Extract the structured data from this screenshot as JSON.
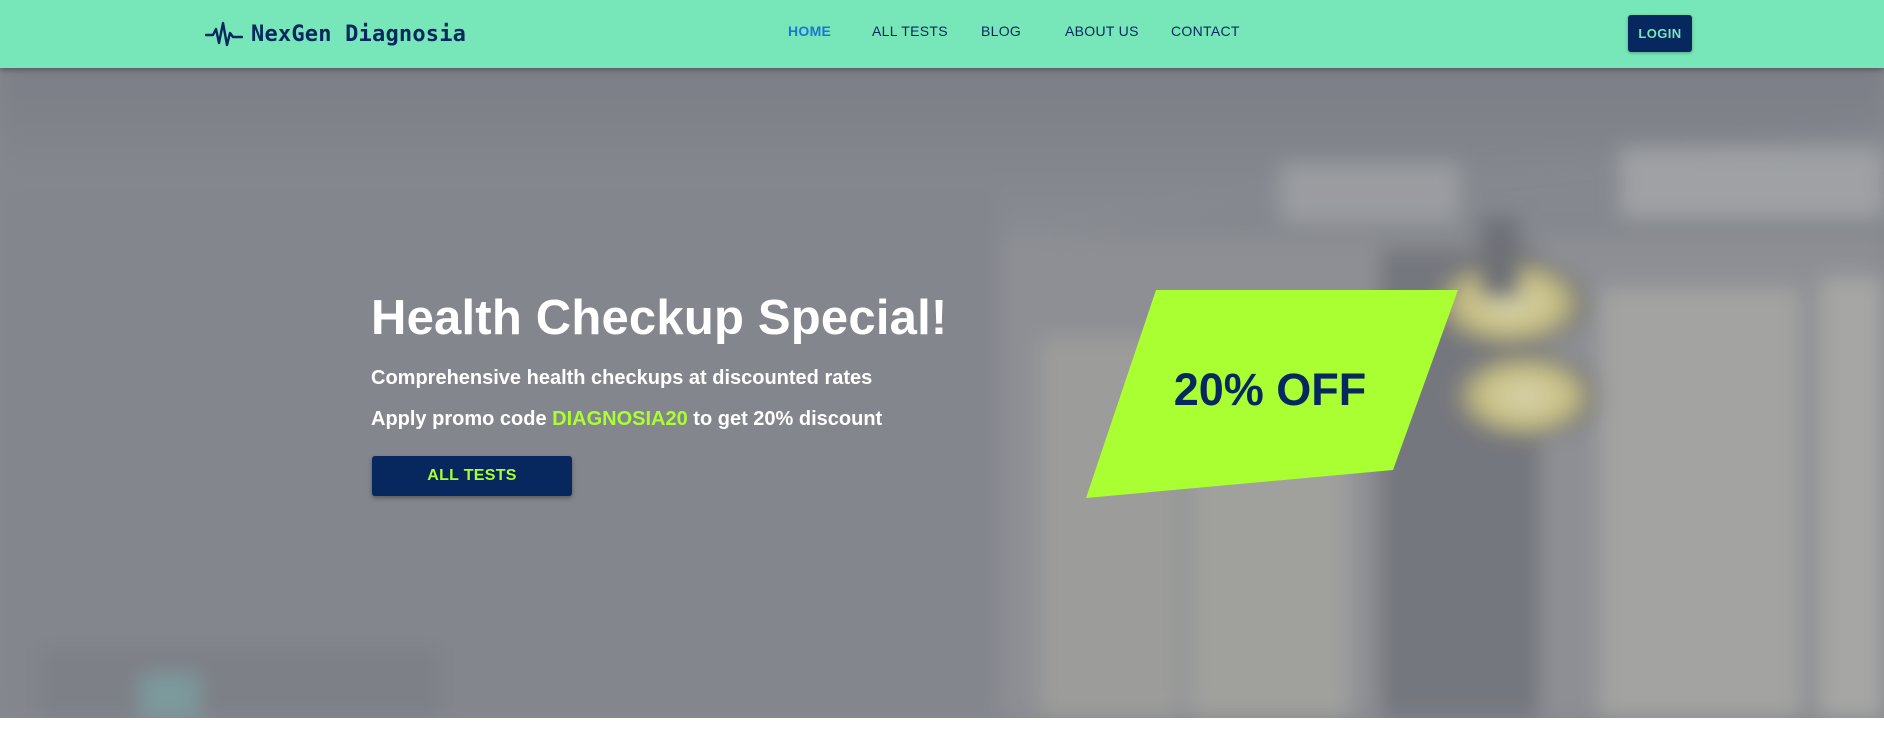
{
  "header": {
    "brand_name": "NexGen Diagnosia",
    "brand_icon": "heartbeat-icon",
    "bg_color": "#77e6b9",
    "nav": [
      {
        "label": "HOME",
        "active": true
      },
      {
        "label": "ALL TESTS",
        "active": false
      },
      {
        "label": "BLOG",
        "active": false
      },
      {
        "label": "ABOUT US",
        "active": false
      },
      {
        "label": "CONTACT",
        "active": false
      }
    ],
    "login_label": "LOGIN"
  },
  "hero": {
    "title": "Health Checkup Special!",
    "subtitle": "Comprehensive health checkups at discounted rates",
    "promo_prefix": "Apply promo code",
    "promo_code": "DIAGNOSIA20",
    "promo_suffix": "to get 20% discount",
    "cta_label": "ALL TESTS",
    "offer_label": "20% OFF",
    "background": "blurred operating room photo",
    "colors": {
      "navy": "#07285e",
      "lime": "#aaff32",
      "active_link": "#1e73d9"
    }
  }
}
